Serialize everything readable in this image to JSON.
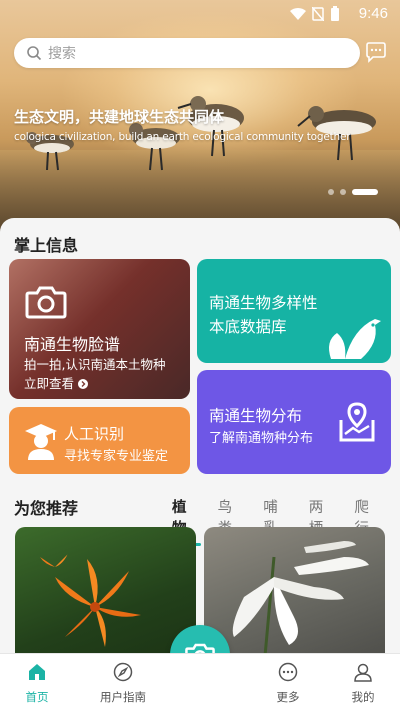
{
  "status": {
    "time": "9:46"
  },
  "search": {
    "placeholder": "搜索"
  },
  "banner": {
    "title": "生态文明，共建地球生态共同体",
    "subtitle": "cologica civilization, build an earth ecological community together"
  },
  "section_info": {
    "title": "掌上信息"
  },
  "cards": {
    "face": {
      "title": "南通生物脸谱",
      "desc1": "拍一拍,认识南通本土物种",
      "desc2": "立即查看"
    },
    "database": {
      "line1": "南通生物多样性",
      "line2": "本底数据库"
    },
    "expert": {
      "title": "人工识别",
      "desc": "寻找专家专业鉴定"
    },
    "distribution": {
      "title": "南通生物分布",
      "desc": "了解南通物种分布"
    }
  },
  "section_recommend": {
    "title": "为您推荐"
  },
  "tabs": [
    "植物",
    "鸟类",
    "哺乳",
    "两栖",
    "爬行"
  ],
  "nav": {
    "home": "首页",
    "guide": "用户指南",
    "more": "更多",
    "mine": "我的"
  },
  "colors": {
    "accent": "#1bb3a5",
    "database": "#16b3a4",
    "distribution": "#6e57e6",
    "expert": "#f39443"
  },
  "icons": [
    "search-icon",
    "message-icon",
    "camera-icon",
    "bird-leaf-icon",
    "map-pin-icon",
    "graduate-icon",
    "home-icon",
    "compass-icon",
    "more-icon",
    "user-icon"
  ]
}
